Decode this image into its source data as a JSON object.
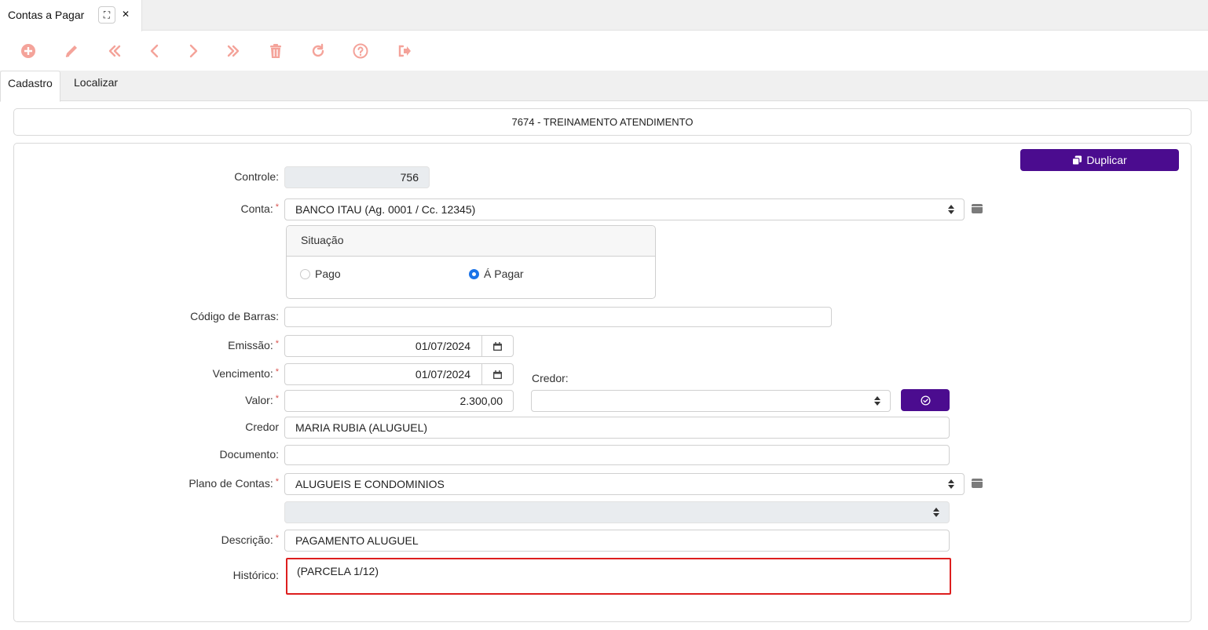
{
  "window": {
    "tab_title": "Contas a Pagar",
    "maximize_glyph": "⛶",
    "close_glyph": "✕"
  },
  "toolbar": {
    "icons": [
      "add-icon",
      "edit-icon",
      "first-icon",
      "previous-icon",
      "next-icon",
      "last-icon",
      "delete-icon",
      "refresh-icon",
      "help-icon",
      "exit-icon"
    ],
    "icon_color": "#f4a39a"
  },
  "tabs": [
    {
      "label": "Cadastro",
      "active": true
    },
    {
      "label": "Localizar",
      "active": false
    }
  ],
  "record_header": "7674 - TREINAMENTO ATENDIMENTO",
  "form": {
    "duplicate_label": "Duplicar",
    "controle_label": "Controle:",
    "controle_value": "756",
    "conta_label": "Conta:",
    "conta_value": "BANCO ITAU (Ag. 0001 / Cc. 12345)",
    "situacao_legend": "Situação",
    "situacao_options": [
      {
        "label": "Pago",
        "selected": false
      },
      {
        "label": "Á Pagar",
        "selected": true
      }
    ],
    "codigo_barras_label": "Código de Barras:",
    "codigo_barras_value": "",
    "emissao_label": "Emissão:",
    "emissao_value": "01/07/2024",
    "vencimento_label": "Vencimento:",
    "vencimento_value": "01/07/2024",
    "credor_select_label": "Credor:",
    "credor_select_value": "",
    "valor_label": "Valor:",
    "valor_value": "2.300,00",
    "credor_label": "Credor",
    "credor_value": "MARIA RUBIA (ALUGUEL)",
    "documento_label": "Documento:",
    "documento_value": "",
    "plano_label": "Plano de Contas:",
    "plano_value": "ALUGUEIS E CONDOMINIOS",
    "subplano_value": "",
    "descricao_label": "Descrição:",
    "descricao_value": "PAGAMENTO ALUGUEL",
    "historico_label": "Histórico:",
    "historico_value": "(PARCELA 1/12)",
    "required_mark": "*"
  },
  "colors": {
    "accent_purple": "#4b0c8f",
    "highlight_red": "#dd1e1e",
    "radio_blue": "#1a73e8"
  }
}
